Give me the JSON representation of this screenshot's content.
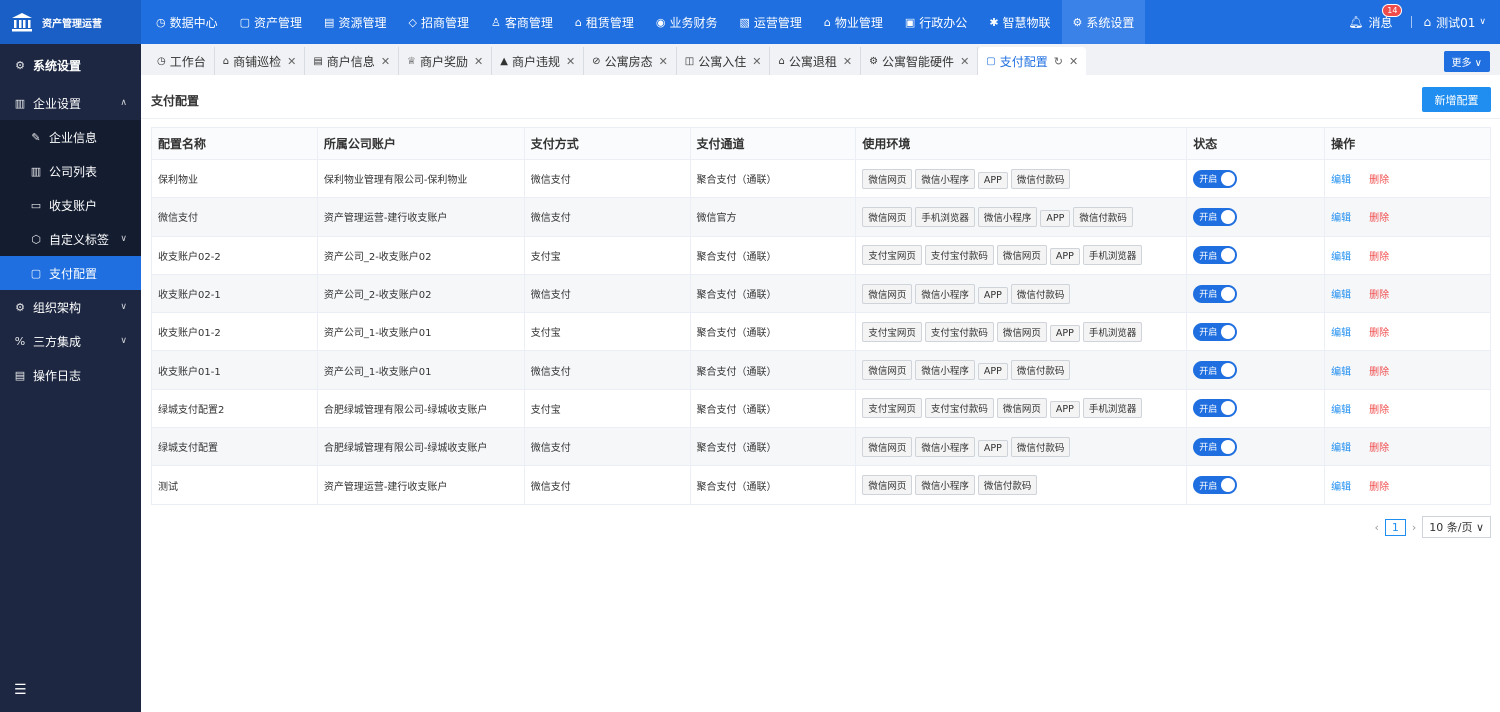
{
  "app": {
    "title": "资产管理运营"
  },
  "topnav": [
    {
      "label": "数据中心",
      "icon": "◷"
    },
    {
      "label": "资产管理",
      "icon": "▢"
    },
    {
      "label": "资源管理",
      "icon": "▤"
    },
    {
      "label": "招商管理",
      "icon": "◇"
    },
    {
      "label": "客商管理",
      "icon": "♙"
    },
    {
      "label": "租赁管理",
      "icon": "⌂"
    },
    {
      "label": "业务财务",
      "icon": "◉"
    },
    {
      "label": "运营管理",
      "icon": "▧"
    },
    {
      "label": "物业管理",
      "icon": "⌂"
    },
    {
      "label": "行政办公",
      "icon": "▣"
    },
    {
      "label": "智慧物联",
      "icon": "✱"
    },
    {
      "label": "系统设置",
      "icon": "⚙"
    }
  ],
  "header": {
    "messages_label": "消息",
    "messages_count": "14",
    "user_name": "测试01"
  },
  "sidebar": {
    "title": "系统设置",
    "items": [
      {
        "label": "企业设置",
        "icon": "▥"
      },
      {
        "label": "企业信息",
        "icon": "✎"
      },
      {
        "label": "公司列表",
        "icon": "▥"
      },
      {
        "label": "收支账户",
        "icon": "▭"
      },
      {
        "label": "自定义标签",
        "icon": "⬡"
      },
      {
        "label": "支付配置",
        "icon": "▢"
      },
      {
        "label": "组织架构",
        "icon": "⚙"
      },
      {
        "label": "三方集成",
        "icon": "%"
      },
      {
        "label": "操作日志",
        "icon": "▤"
      }
    ]
  },
  "tabs": [
    {
      "label": "工作台",
      "icon": "◷"
    },
    {
      "label": "商铺巡检",
      "icon": "⌂"
    },
    {
      "label": "商户信息",
      "icon": "▤"
    },
    {
      "label": "商户奖励",
      "icon": "♕"
    },
    {
      "label": "商户违规",
      "icon": "▲"
    },
    {
      "label": "公寓房态",
      "icon": "⊘"
    },
    {
      "label": "公寓入住",
      "icon": "◫"
    },
    {
      "label": "公寓退租",
      "icon": "⌂"
    },
    {
      "label": "公寓智能硬件",
      "icon": "⚙"
    },
    {
      "label": "支付配置",
      "icon": "▢"
    }
  ],
  "more_label": "更多 ∨",
  "page": {
    "title": "支付配置",
    "add_button": "新增配置"
  },
  "table": {
    "headers": [
      "配置名称",
      "所属公司账户",
      "支付方式",
      "支付通道",
      "使用环境",
      "状态",
      "操作"
    ],
    "rows": [
      {
        "name": "保利物业",
        "account": "保利物业管理有限公司-保利物业",
        "method": "微信支付",
        "channel": "聚合支付（通联）",
        "envs": [
          "微信网页",
          "微信小程序",
          "APP",
          "微信付款码"
        ],
        "status": "开启"
      },
      {
        "name": "微信支付",
        "account": "资产管理运营-建行收支账户",
        "method": "微信支付",
        "channel": "微信官方",
        "envs": [
          "微信网页",
          "手机浏览器",
          "微信小程序",
          "APP",
          "微信付款码"
        ],
        "status": "开启"
      },
      {
        "name": "收支账户02-2",
        "account": "资产公司_2-收支账户02",
        "method": "支付宝",
        "channel": "聚合支付（通联）",
        "envs": [
          "支付宝网页",
          "支付宝付款码",
          "微信网页",
          "APP",
          "手机浏览器"
        ],
        "status": "开启"
      },
      {
        "name": "收支账户02-1",
        "account": "资产公司_2-收支账户02",
        "method": "微信支付",
        "channel": "聚合支付（通联）",
        "envs": [
          "微信网页",
          "微信小程序",
          "APP",
          "微信付款码"
        ],
        "status": "开启"
      },
      {
        "name": "收支账户01-2",
        "account": "资产公司_1-收支账户01",
        "method": "支付宝",
        "channel": "聚合支付（通联）",
        "envs": [
          "支付宝网页",
          "支付宝付款码",
          "微信网页",
          "APP",
          "手机浏览器"
        ],
        "status": "开启"
      },
      {
        "name": "收支账户01-1",
        "account": "资产公司_1-收支账户01",
        "method": "微信支付",
        "channel": "聚合支付（通联）",
        "envs": [
          "微信网页",
          "微信小程序",
          "APP",
          "微信付款码"
        ],
        "status": "开启"
      },
      {
        "name": "绿城支付配置2",
        "account": "合肥绿城管理有限公司-绿城收支账户",
        "method": "支付宝",
        "channel": "聚合支付（通联）",
        "envs": [
          "支付宝网页",
          "支付宝付款码",
          "微信网页",
          "APP",
          "手机浏览器"
        ],
        "status": "开启"
      },
      {
        "name": "绿城支付配置",
        "account": "合肥绿城管理有限公司-绿城收支账户",
        "method": "微信支付",
        "channel": "聚合支付（通联）",
        "envs": [
          "微信网页",
          "微信小程序",
          "APP",
          "微信付款码"
        ],
        "status": "开启"
      },
      {
        "name": "测试",
        "account": "资产管理运营-建行收支账户",
        "method": "微信支付",
        "channel": "聚合支付（通联）",
        "envs": [
          "微信网页",
          "微信小程序",
          "微信付款码"
        ],
        "status": "开启"
      }
    ],
    "edit_label": "编辑",
    "delete_label": "删除"
  },
  "pager": {
    "prev": "‹",
    "current": "1",
    "next": "›",
    "page_size": "10 条/页 ∨"
  }
}
